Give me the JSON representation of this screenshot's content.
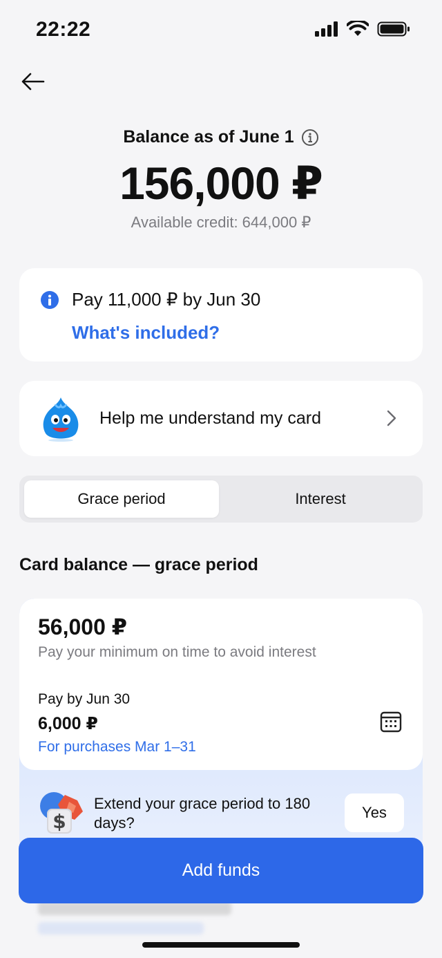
{
  "status_bar": {
    "time": "22:22"
  },
  "balance": {
    "title": "Balance as of June 1",
    "amount": "156,000 ₽",
    "available_credit": "Available credit: 644,000 ₽"
  },
  "payment_notice": {
    "text": "Pay 11,000 ₽ by Jun 30",
    "link": "What's included?"
  },
  "help": {
    "label": "Help me understand my card"
  },
  "tabs": [
    {
      "label": "Grace period",
      "active": true
    },
    {
      "label": "Interest",
      "active": false
    }
  ],
  "section_title": "Card balance — grace period",
  "grace": {
    "amount": "56,000 ₽",
    "description": "Pay your minimum on time to avoid interest",
    "pay_by": "Pay by Jun 30",
    "min_amount": "6,000 ₽",
    "purchases": "For purchases Mar 1–31"
  },
  "extend": {
    "text": "Extend your grace period to 180 days?",
    "yes_label": "Yes"
  },
  "primary_action": {
    "label": "Add funds"
  },
  "colors": {
    "accent": "#2d68e8",
    "link": "#2f6ee8",
    "background": "#f5f5f7"
  },
  "icons": [
    "back-arrow-icon",
    "info-icon",
    "mascot-icon",
    "chevron-right-icon",
    "calendar-icon",
    "money-icon",
    "signal-icon",
    "wifi-icon",
    "battery-icon"
  ]
}
